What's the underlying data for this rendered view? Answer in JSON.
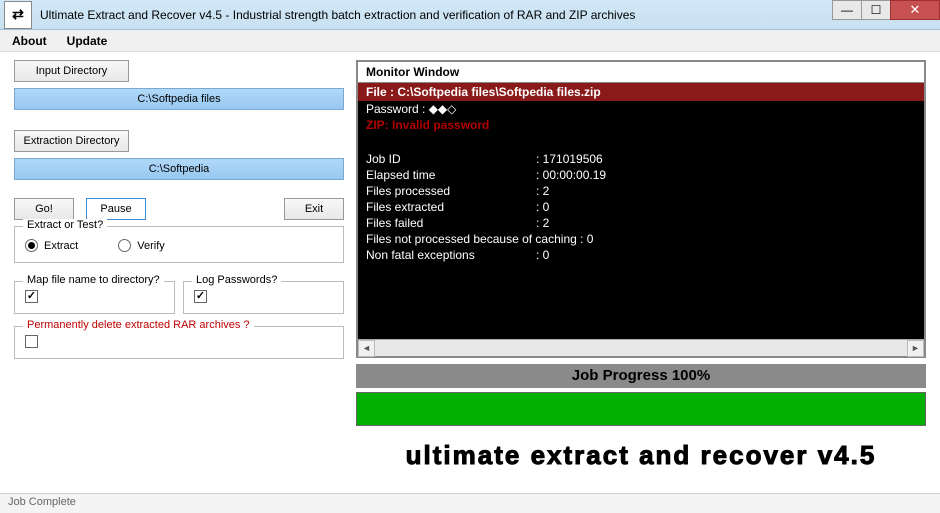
{
  "title": "Ultimate Extract and Recover v4.5  - Industrial strength batch extraction and verification of RAR and ZIP archives",
  "menu": {
    "about": "About",
    "update": "Update"
  },
  "left": {
    "input_btn": "Input Directory",
    "input_path": "C:\\Softpedia files",
    "extract_btn": "Extraction Directory",
    "extract_path": "C:\\Softpedia",
    "go": "Go!",
    "pause": "Pause",
    "exit": "Exit",
    "mode_legend": "Extract or Test?",
    "mode_extract": "Extract",
    "mode_verify": "Verify",
    "mode_selected": "extract",
    "map_legend": "Map file name to directory?",
    "map_checked": true,
    "log_legend": "Log Passwords?",
    "log_checked": true,
    "delete_legend": "Permanently delete extracted RAR archives  ?",
    "delete_checked": false
  },
  "monitor": {
    "header": "Monitor Window",
    "file_line": "File : C:\\Softpedia files\\Softpedia files.zip",
    "password_line": "Password : ◆◆◇",
    "error_line": "ZIP: Invalid password",
    "stats": [
      {
        "label": "Job ID",
        "value": "171019506"
      },
      {
        "label": "Elapsed time",
        "value": "00:00:00.19"
      },
      {
        "label": "Files processed",
        "value": "2"
      },
      {
        "label": "Files extracted",
        "value": "0"
      },
      {
        "label": "Files failed",
        "value": "2"
      },
      {
        "label": "Files not processed because of caching",
        "value": "0"
      },
      {
        "label": "Non fatal exceptions",
        "value": "0"
      }
    ]
  },
  "progress": {
    "label": "Job Progress 100%",
    "percent": 100
  },
  "banner": "ultimate extract and recover v4.5",
  "status": "Job Complete"
}
